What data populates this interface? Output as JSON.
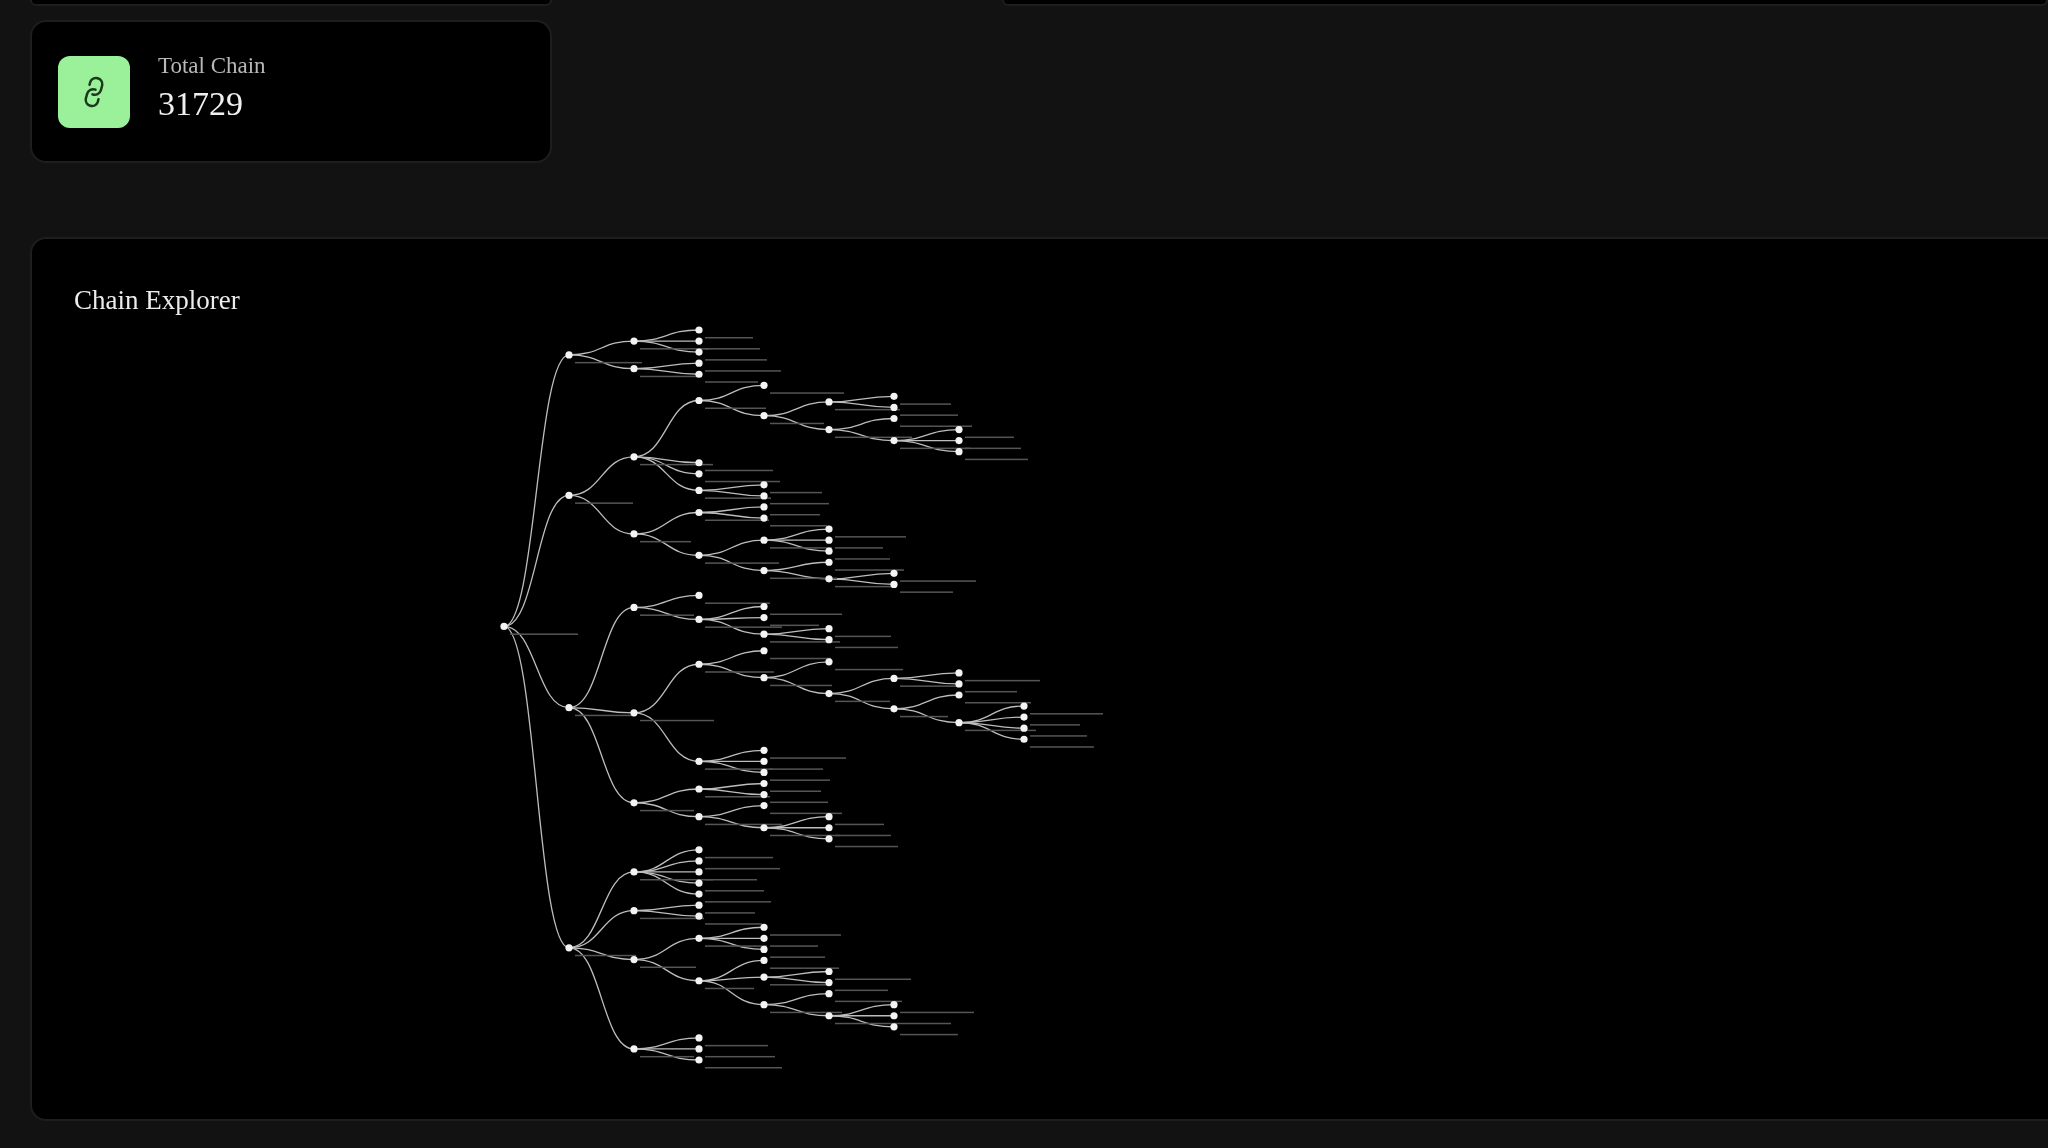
{
  "stat_card": {
    "label": "Total Chain",
    "value": "31729"
  },
  "chain_explorer": {
    "title": "Chain Explorer"
  }
}
